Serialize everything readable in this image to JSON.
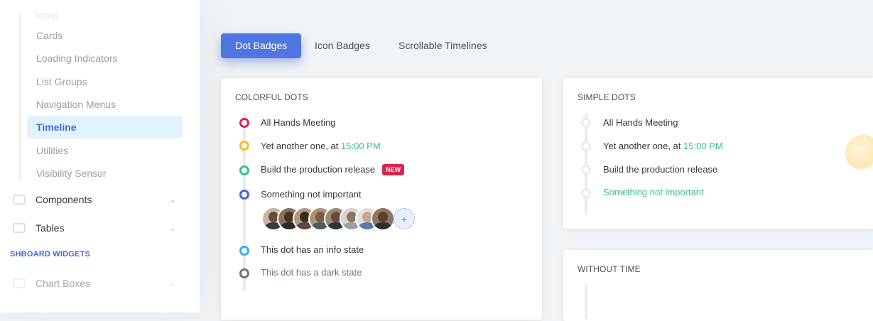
{
  "sidebar": {
    "partial_top": "Icons",
    "links": [
      {
        "label": "Cards"
      },
      {
        "label": "Loading Indicators"
      },
      {
        "label": "List Groups"
      },
      {
        "label": "Navigation Menus"
      },
      {
        "label": "Timeline"
      },
      {
        "label": "Utilities"
      },
      {
        "label": "Visibility Sensor"
      }
    ],
    "groups": [
      {
        "label": "Components",
        "icon": "components-icon"
      },
      {
        "label": "Tables",
        "icon": "tables-icon"
      }
    ],
    "heading": "SHBOARD WIDGETS",
    "chart_boxes": "Chart Boxes"
  },
  "tabs": [
    {
      "label": "Dot Badges"
    },
    {
      "label": "Icon Badges"
    },
    {
      "label": "Scrollable Timelines"
    }
  ],
  "colorful": {
    "title": "COLORFUL DOTS",
    "items": [
      {
        "text": "All Hands Meeting",
        "color": "#d92550"
      },
      {
        "text": "Yet another one, at ",
        "time": "15:00 PM",
        "color": "#f7b924"
      },
      {
        "text": "Build the production release",
        "badge": "NEW",
        "color": "#3ac47d"
      },
      {
        "text": "Something not important",
        "color": "#3f6ad8"
      },
      {
        "text": "This dot has an info state",
        "color": "#30b1ff"
      },
      {
        "text": "This dot has a dark state",
        "color": "#6c757d"
      }
    ],
    "add_label": "+"
  },
  "simple": {
    "title": "SIMPLE DOTS",
    "items": [
      {
        "text": "All Hands Meeting"
      },
      {
        "text": "Yet another one, at ",
        "time": "15:00 PM"
      },
      {
        "text": "Build the production release"
      },
      {
        "text": "Something not important"
      }
    ]
  },
  "without_time": {
    "title": "WITHOUT TIME"
  },
  "colors": {
    "accent": "#3f6ad8",
    "success": "#3ac47d",
    "danger": "#d92550",
    "warning": "#f7b924",
    "info": "#30b1ff"
  }
}
